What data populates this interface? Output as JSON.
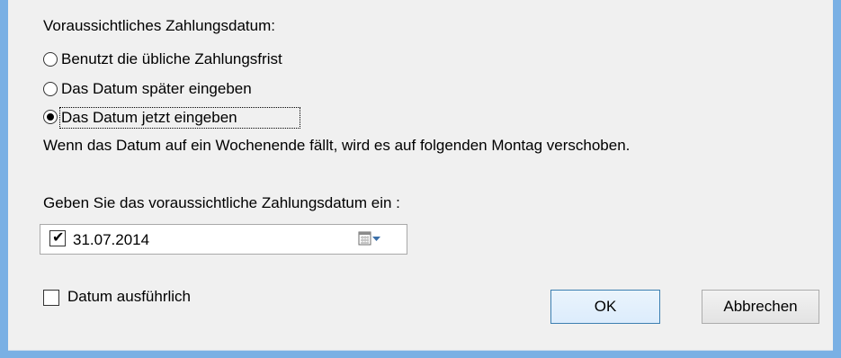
{
  "dialog": {
    "section_heading": "Voraussichtliches Zahlungsdatum:",
    "radio_options": [
      {
        "label": "Benutzt die übliche Zahlungsfrist",
        "selected": false
      },
      {
        "label": "Das Datum später eingeben",
        "selected": false
      },
      {
        "label": "Das Datum jetzt eingeben",
        "selected": true
      }
    ],
    "weekend_note": "Wenn das Datum auf ein Wochenende fällt, wird es auf folgenden Montag verschoben.",
    "date_prompt": "Geben Sie das voraussichtliche Zahlungsdatum ein :",
    "date_picker": {
      "checked": true,
      "value": "31.07.2014",
      "calendar_icon": "calendar-icon",
      "dropdown_icon": "chevron-down-icon"
    },
    "long_date_checkbox": {
      "label": "Datum ausführlich",
      "checked": false
    },
    "buttons": {
      "ok": "OK",
      "cancel": "Abbrechen"
    }
  },
  "colors": {
    "window_border": "#7ab0e4",
    "background": "#f0f0f0",
    "default_button_border": "#3c7fb1"
  }
}
